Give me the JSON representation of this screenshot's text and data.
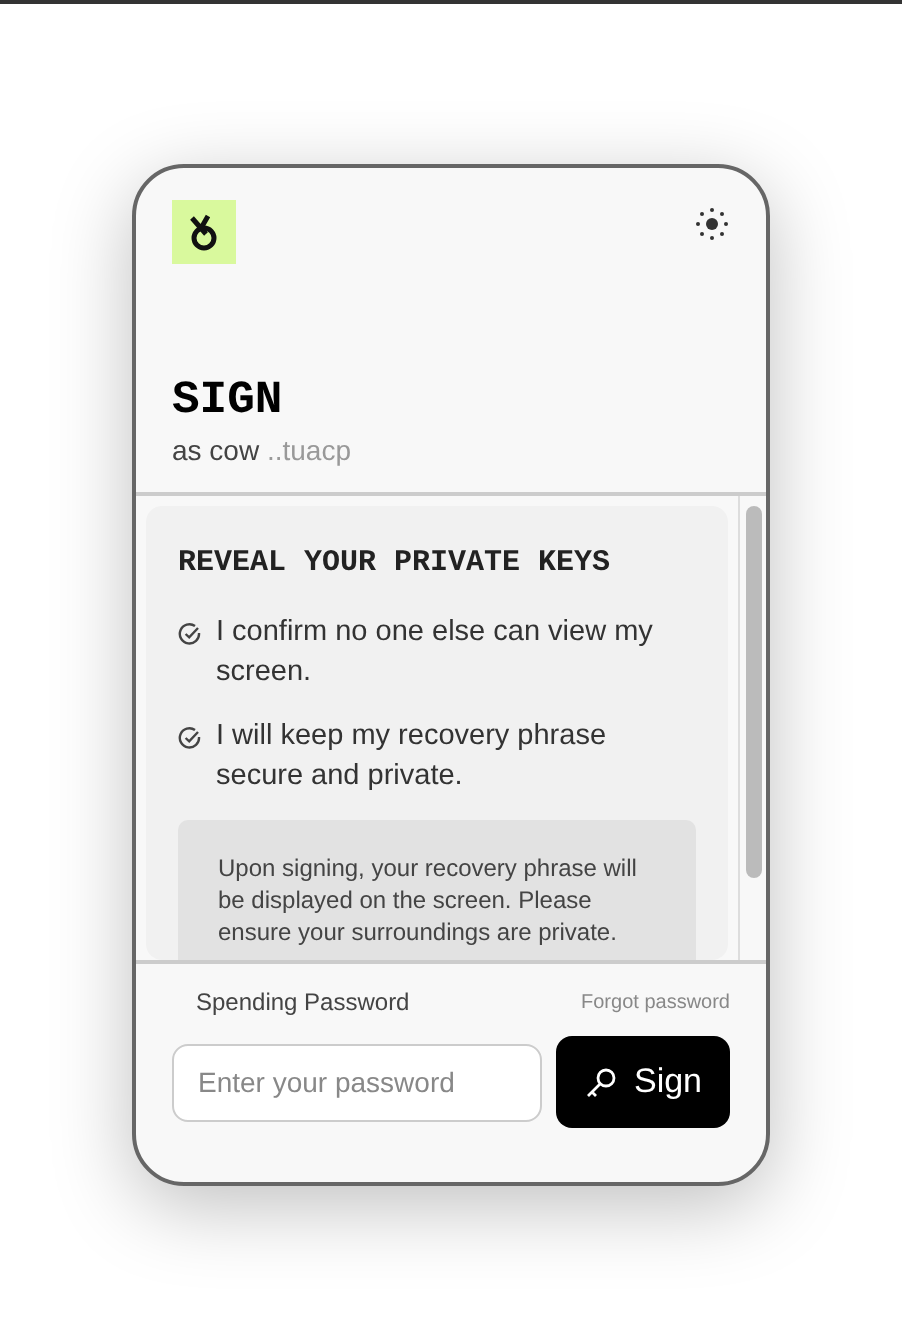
{
  "header": {
    "title": "SIGN",
    "subtitle_prefix": "as cow",
    "subtitle_address": "..tuacp"
  },
  "notice": {
    "heading": "REVEAL YOUR PRIVATE KEYS",
    "confirmations": [
      {
        "text": "I confirm no one else can view my screen."
      },
      {
        "text": "I will keep my recovery phrase secure and private."
      }
    ],
    "info": "Upon signing, your recovery phrase will be displayed on the screen. Please ensure your surroundings are private."
  },
  "footer": {
    "password_label": "Spending Password",
    "forgot_link": "Forgot password",
    "password": {
      "placeholder": "Enter your password"
    },
    "sign_button": "Sign"
  }
}
